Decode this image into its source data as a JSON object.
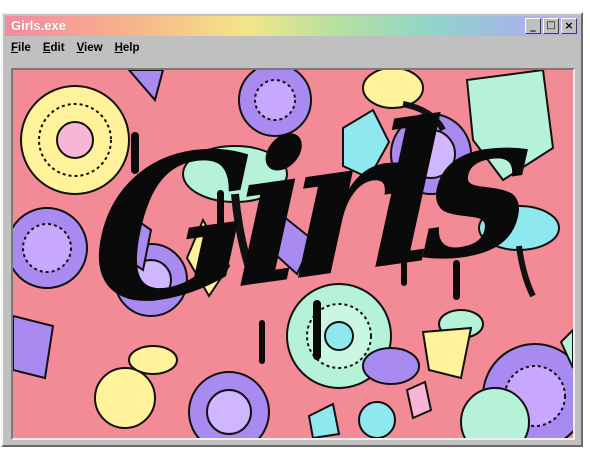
{
  "window": {
    "title": "Girls.exe",
    "controls": {
      "minimize": "_",
      "maximize": "□",
      "close": "×"
    }
  },
  "menu": [
    {
      "label": "File",
      "hotkey": "F",
      "rest": "ile"
    },
    {
      "label": "Edit",
      "hotkey": "E",
      "rest": "dit"
    },
    {
      "label": "View",
      "hotkey": "V",
      "rest": "iew"
    },
    {
      "label": "Help",
      "hotkey": "H",
      "rest": "elp"
    }
  ],
  "artwork": {
    "word": "Girls",
    "background_color": "#f28b95",
    "palette": [
      "#fff29a",
      "#b6f2d8",
      "#a98af0",
      "#8fe8ee",
      "#111111"
    ]
  }
}
